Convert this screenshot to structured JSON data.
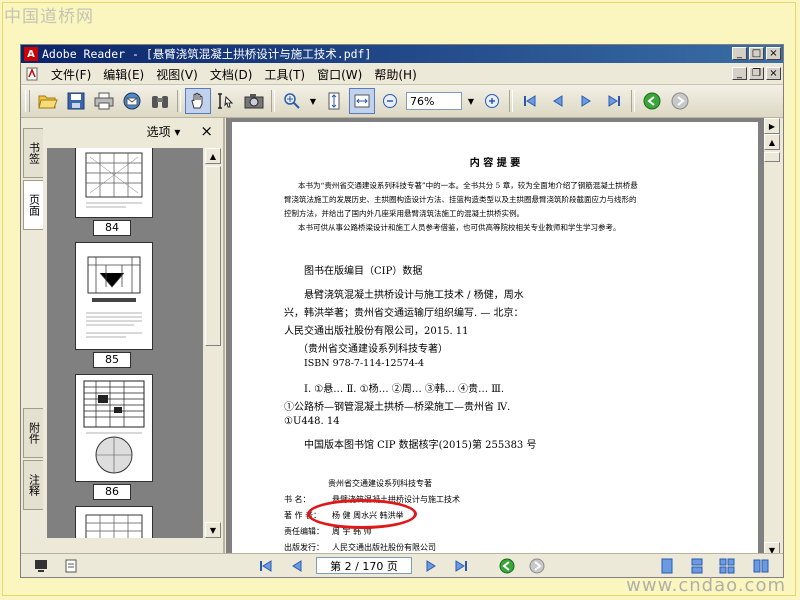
{
  "watermark_top": "中国道桥网",
  "watermark_bottom": "www.cndao.com",
  "window": {
    "title": "Adobe Reader - [悬臂浇筑混凝土拱桥设计与施工技术.pdf]"
  },
  "menu": [
    "文件(F)",
    "编辑(E)",
    "视图(V)",
    "文档(D)",
    "工具(T)",
    "窗口(W)",
    "帮助(H)"
  ],
  "toolbar": {
    "zoom_value": "76%"
  },
  "side_tabs": [
    "书签",
    "页面",
    "附件",
    "注释"
  ],
  "panel": {
    "options_label": "选项 ▾",
    "close": "×",
    "thumb_pages": [
      "84",
      "85",
      "86"
    ]
  },
  "page": {
    "summary_title": "内  容  提  要",
    "summary_p1_l1": "本书为“贵州省交通建设系列科技专著”中的一本。全书共分 5 章，较为全面地介绍了钢筋混凝土拱桥悬",
    "summary_p1_l2": "臂浇筑法施工的发展历史、主拱圈构造设计方法、挂篮构造类型以及主拱圈悬臂浇筑阶段截面应力与线形的",
    "summary_p1_l3": "控制方法，并给出了国内外几座采用悬臂浇筑法施工的混凝土拱桥实例。",
    "summary_p2": "本书可供从事公路桥梁设计和施工人员参考借鉴，也可供高等院校相关专业教师和学生学习参考。",
    "cip_heading": "图书在版编目（CIP）数据",
    "cip_l1": "悬臂浇筑混凝土拱桥设计与施工技术 / 杨健，周水",
    "cip_l2": "兴，韩洪举著；贵州省交通运输厅组织编写. — 北京：",
    "cip_l3": "人民交通出版社股份有限公司，2015. 11",
    "cip_l4": "（贵州省交通建设系列科技专著）",
    "cip_l5": "ISBN  978-7-114-12574-4",
    "cip_l6": "Ⅰ. ①悬…  Ⅱ. ①杨…  ②周…  ③韩…  ④贵…  Ⅲ.",
    "cip_l7": "①公路桥—钢管混凝土拱桥—桥梁施工—贵州省  Ⅳ.",
    "cip_l8": "①U448. 14",
    "cip_l9": "中国版本图书馆 CIP 数据核字(2015)第 255383 号",
    "series_title": "贵州省交通建设系列科技专著",
    "book_label": "书      名：",
    "book_name": "悬臂浇筑混凝土拱桥设计与施工技术",
    "author_label": "著  作  者：",
    "author_names": "杨  健    周水兴    韩洪举",
    "editor_label": "责任编辑：",
    "editor_names": "周  宇  韩  帅",
    "publisher_label": "出版发行：",
    "publisher_name": "人民交通出版社股份有限公司"
  },
  "status": {
    "page_field": "第 2 / 170 页"
  },
  "colors": {
    "highlight": "#e01818",
    "title_bar": "#0a246a",
    "page_bg": "#ffffff",
    "viewer_bg": "#808080"
  }
}
